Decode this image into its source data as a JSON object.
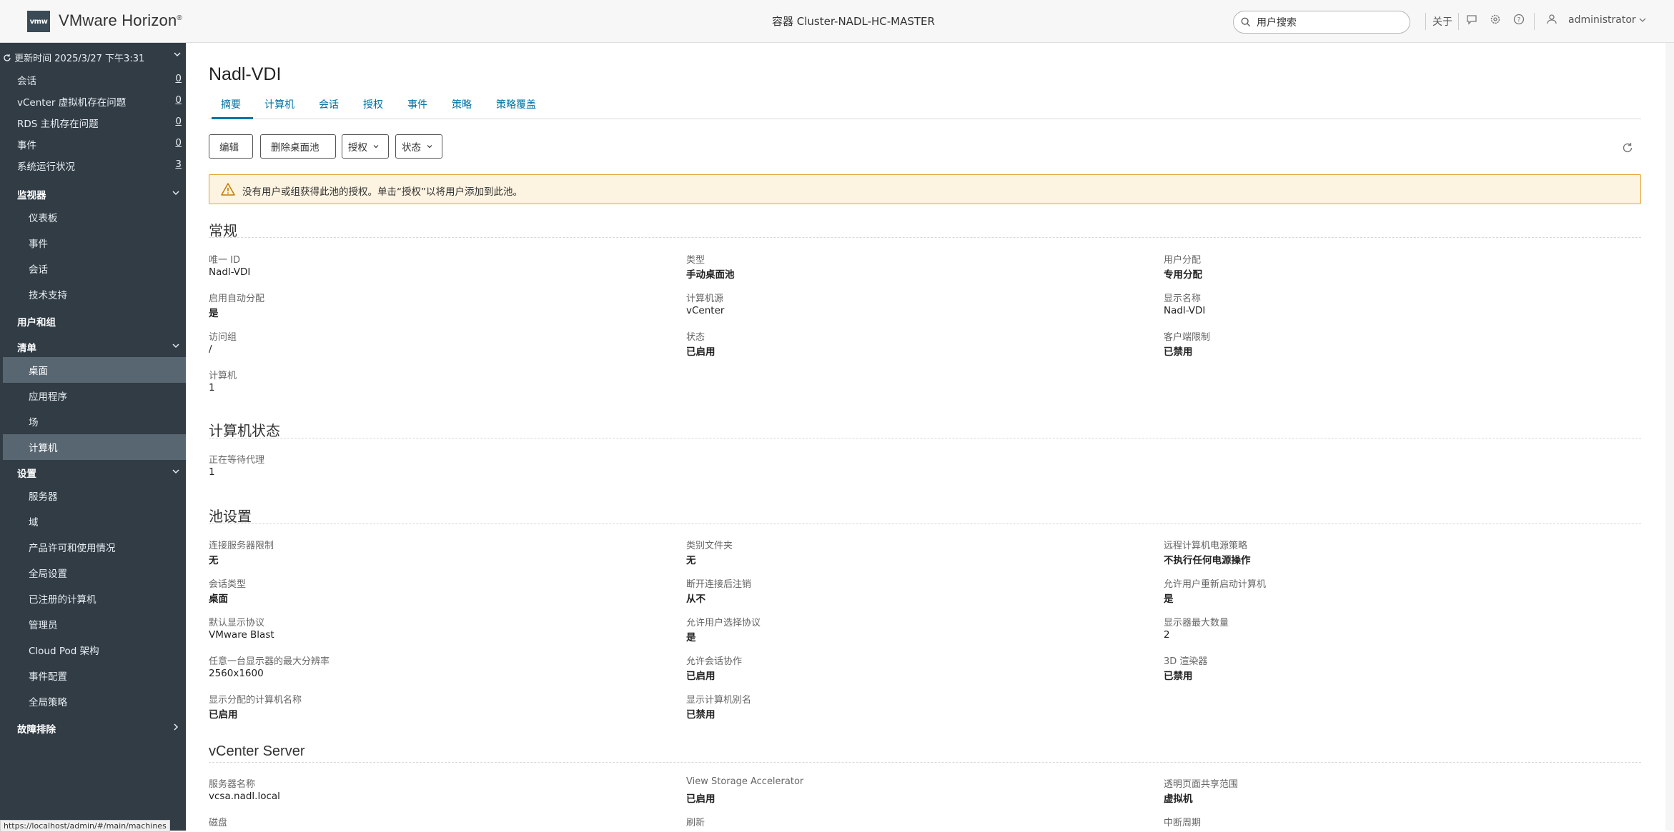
{
  "header": {
    "logo_text": "vmw",
    "brand": "VMware Horizon",
    "brand_mark": "®",
    "container": "容器 Cluster-NADL-HC-MASTER",
    "search_placeholder": "用户搜索",
    "about": "关于",
    "user": "administrator"
  },
  "sidebar": {
    "refresh_text": "更新时间 2025/3/27 下午3:31",
    "counts": [
      {
        "label": "会话",
        "count": "0"
      },
      {
        "label": "vCenter 虚拟机存在问题",
        "count": "0"
      },
      {
        "label": "RDS 主机存在问题",
        "count": "0"
      },
      {
        "label": "事件",
        "count": "0"
      },
      {
        "label": "系统运行状况",
        "count": "3"
      }
    ],
    "monitor": {
      "title": "监视器",
      "items": [
        "仪表板",
        "事件",
        "会话",
        "技术支持"
      ]
    },
    "users_groups": "用户和组",
    "inventory": {
      "title": "清单",
      "items": [
        "桌面",
        "应用程序",
        "场",
        "计算机"
      ]
    },
    "settings": {
      "title": "设置",
      "items": [
        "服务器",
        "域",
        "产品许可和使用情况",
        "全局设置",
        "已注册的计算机",
        "管理员",
        "Cloud Pod 架构",
        "事件配置",
        "全局策略"
      ]
    },
    "troubleshoot": "故障排除"
  },
  "status_url": "https://localhost/admin/#/main/machines",
  "page": {
    "title": "Nadl-VDI",
    "tabs": [
      "摘要",
      "计算机",
      "会话",
      "授权",
      "事件",
      "策略",
      "策略覆盖"
    ],
    "active_tab": "摘要",
    "buttons": {
      "edit": "编辑",
      "delete_pool": "删除桌面池",
      "entitle": "授权",
      "status": "状态"
    },
    "alert": "没有用户或组获得此池的授权。单击“授权”以将用户添加到此池。",
    "general": {
      "title": "常规",
      "fields": [
        {
          "label": "唯一 ID",
          "value": "Nadl-VDI",
          "bold": false
        },
        {
          "label": "类型",
          "value": "手动桌面池",
          "bold": true
        },
        {
          "label": "用户分配",
          "value": "专用分配",
          "bold": true
        },
        {
          "label": "启用自动分配",
          "value": "是",
          "bold": true
        },
        {
          "label": "计算机源",
          "value": "vCenter",
          "bold": false
        },
        {
          "label": "显示名称",
          "value": "Nadl-VDI",
          "bold": false
        },
        {
          "label": "访问组",
          "value": "/",
          "bold": false
        },
        {
          "label": "状态",
          "value": "已启用",
          "bold": true
        },
        {
          "label": "客户端限制",
          "value": "已禁用",
          "bold": true
        },
        {
          "label": "计算机",
          "value": "1",
          "bold": false
        }
      ]
    },
    "machine_status": {
      "title": "计算机状态",
      "fields": [
        {
          "label": "正在等待代理",
          "value": "1",
          "bold": false
        }
      ]
    },
    "pool_settings": {
      "title": "池设置",
      "fields": [
        {
          "label": "连接服务器限制",
          "value": "无",
          "bold": true
        },
        {
          "label": "类别文件夹",
          "value": "无",
          "bold": true
        },
        {
          "label": "远程计算机电源策略",
          "value": "不执行任何电源操作",
          "bold": true
        },
        {
          "label": "会话类型",
          "value": "桌面",
          "bold": true
        },
        {
          "label": "断开连接后注销",
          "value": "从不",
          "bold": true
        },
        {
          "label": "允许用户重新启动计算机",
          "value": "是",
          "bold": true
        },
        {
          "label": "默认显示协议",
          "value": "VMware Blast",
          "bold": false
        },
        {
          "label": "允许用户选择协议",
          "value": "是",
          "bold": true
        },
        {
          "label": "显示器最大数量",
          "value": "2",
          "bold": false
        },
        {
          "label": "任意一台显示器的最大分辨率",
          "value": "2560x1600",
          "bold": false
        },
        {
          "label": "允许会话协作",
          "value": "已启用",
          "bold": true
        },
        {
          "label": "3D 渲染器",
          "value": "已禁用",
          "bold": true
        },
        {
          "label": "显示分配的计算机名称",
          "value": "已启用",
          "bold": true
        },
        {
          "label": "显示计算机别名",
          "value": "已禁用",
          "bold": true
        }
      ]
    },
    "vcenter": {
      "title": "vCenter Server",
      "fields": [
        {
          "label": "服务器名称",
          "value": "vcsa.nadl.local",
          "bold": false
        },
        {
          "label": "View Storage Accelerator",
          "value": "已启用",
          "bold": true
        },
        {
          "label": "透明页面共享范围",
          "value": "虚拟机",
          "bold": true
        },
        {
          "label": "磁盘",
          "value": "",
          "bold": false
        },
        {
          "label": "刷新",
          "value": "",
          "bold": false
        },
        {
          "label": "中断周期",
          "value": "",
          "bold": false
        }
      ]
    }
  }
}
